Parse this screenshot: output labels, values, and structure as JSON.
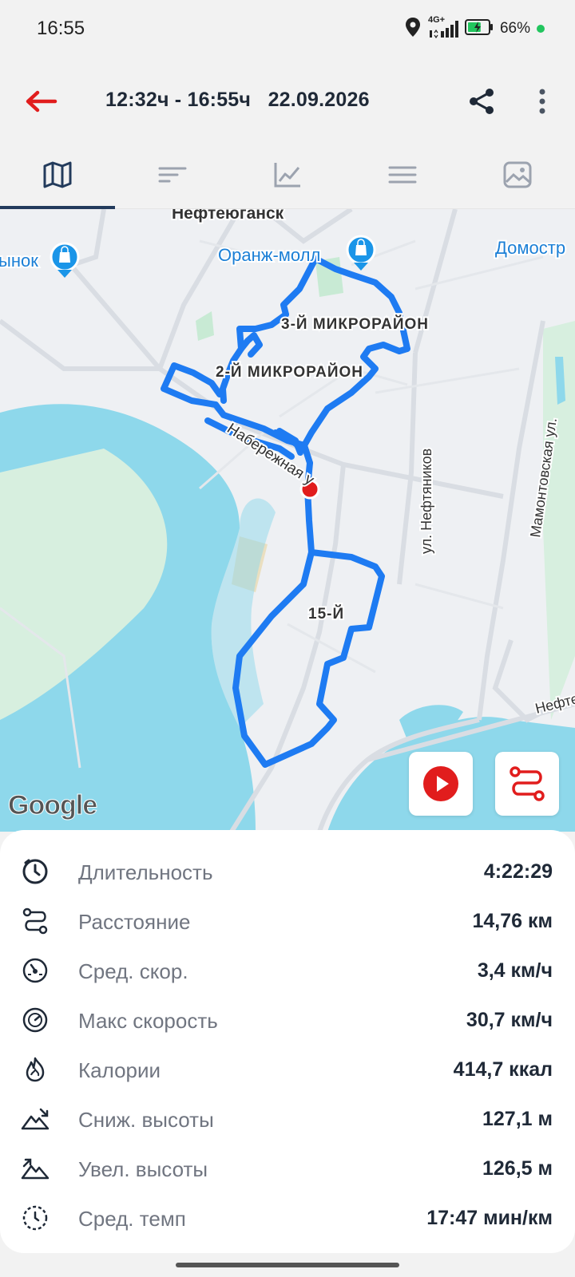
{
  "status_bar": {
    "time": "16:55",
    "network": "4G+",
    "battery_percent": "66%",
    "battery_level": 0.66
  },
  "header": {
    "title": "12:32ч - 16:55ч   22.09.2026",
    "back_icon": "arrow-left-icon",
    "share_icon": "share-icon",
    "more_icon": "more-vertical-icon"
  },
  "tabs": [
    {
      "icon": "map-icon",
      "active": true
    },
    {
      "icon": "sort-lines-icon",
      "active": false
    },
    {
      "icon": "chart-icon",
      "active": false
    },
    {
      "icon": "menu-icon",
      "active": false
    },
    {
      "icon": "photo-icon",
      "active": false
    }
  ],
  "map": {
    "labels": {
      "city": "Нефтеюганск",
      "poi_left": "ынок",
      "poi_mall": "Оранж-молл",
      "poi_right": "Домостр",
      "district_3": "3-Й МИКРОРАЙОН",
      "district_2": "2-Й МИКРОРАЙОН",
      "district_15": "15-Й",
      "street_embankment": "Набережная у",
      "street_neftyanikov": "ул. Нефтяников",
      "street_mamontovskaya": "Мамонтовская ул.",
      "street_nefte": "Нефте"
    },
    "attribution": "Google",
    "route_color": "#1e7bf2",
    "marker_color": "#e11d1d"
  },
  "stats": [
    {
      "icon": "clock-icon",
      "label": "Длительность",
      "value": "4:22:29"
    },
    {
      "icon": "route-distance-icon",
      "label": "Расстояние",
      "value": "14,76 км"
    },
    {
      "icon": "speedometer-icon",
      "label": "Сред. скор.",
      "value": "3,4 км/ч"
    },
    {
      "icon": "max-speed-icon",
      "label": "Макс скорость",
      "value": "30,7 км/ч"
    },
    {
      "icon": "flame-icon",
      "label": "Калории",
      "value": "414,7 ккал"
    },
    {
      "icon": "elevation-down-icon",
      "label": "Сниж. высоты",
      "value": "127,1 м"
    },
    {
      "icon": "elevation-up-icon",
      "label": "Увел. высоты",
      "value": "126,5 м"
    },
    {
      "icon": "pace-icon",
      "label": "Сред. темп",
      "value": "17:47 мин/км"
    }
  ]
}
